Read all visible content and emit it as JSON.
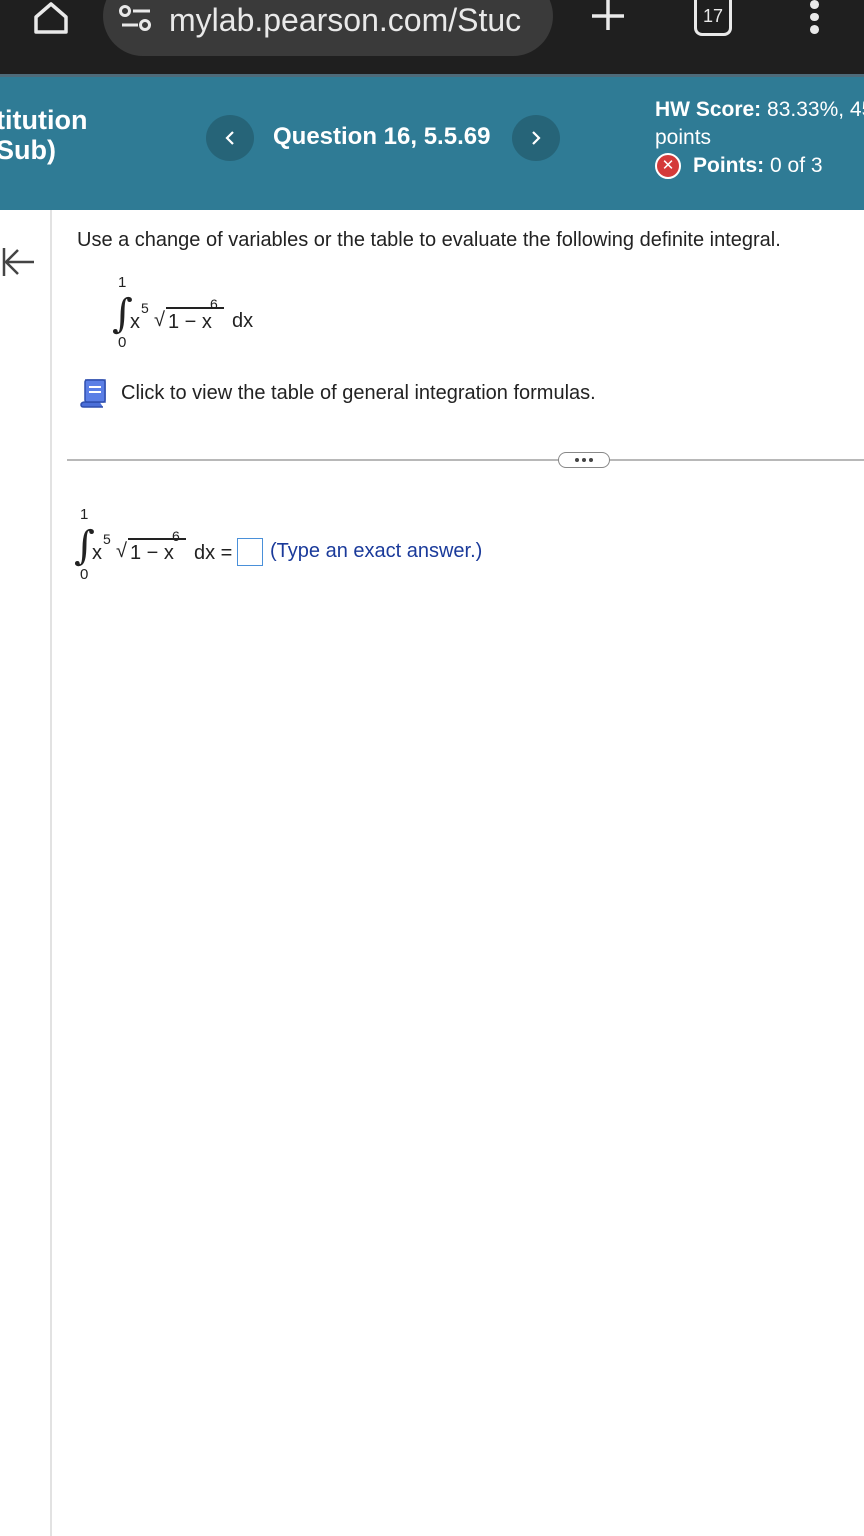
{
  "browser": {
    "url": "mylab.pearson.com/Stuc",
    "tab_count": "17"
  },
  "header": {
    "assignment_title_line1": "titution",
    "assignment_title_line2": "Sub)",
    "question_label": "Question 16, 5.5.69",
    "hw_score_label": "HW Score:",
    "hw_score_value": "83.33%, 45",
    "hw_score_unit": "points",
    "points_label": "Points:",
    "points_value": "0 of 3"
  },
  "question": {
    "prompt": "Use a change of variables or the table to evaluate the following definite integral.",
    "integral": {
      "upper_limit": "1",
      "lower_limit": "0",
      "base1": "x",
      "exp1": "5",
      "radicand_prefix": "1 − x",
      "exp2": "6",
      "differential": "dx"
    },
    "table_link": "Click to view the table of general integration formulas."
  },
  "answer": {
    "equals": "dx =",
    "value": "",
    "hint": "(Type an exact answer.)"
  },
  "colors": {
    "header_bg": "#2f7b95",
    "nav_button_bg": "#266478",
    "chrome_bg": "#1f1f1f",
    "urlbar_bg": "#3a3a3a",
    "hint_text": "#1a3a9a",
    "answer_box_border": "#4a90d9",
    "error_icon": "#d43a3a"
  }
}
